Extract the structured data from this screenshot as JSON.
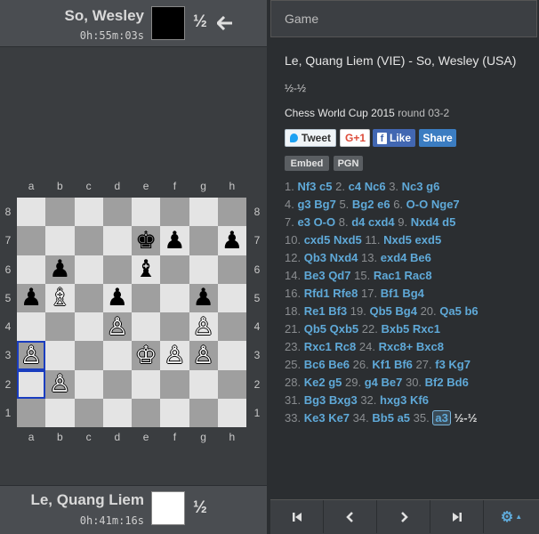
{
  "players": {
    "top": {
      "name": "So, Wesley",
      "clock": "0h:55m:03s",
      "color": "#000000",
      "result": "½"
    },
    "bottom": {
      "name": "Le, Quang Liem",
      "clock": "0h:41m:16s",
      "color": "#ffffff",
      "result": "½"
    }
  },
  "board": {
    "files": [
      "a",
      "b",
      "c",
      "d",
      "e",
      "f",
      "g",
      "h"
    ],
    "ranks": [
      "8",
      "7",
      "6",
      "5",
      "4",
      "3",
      "2",
      "1"
    ],
    "pieces": [
      {
        "sq": "e7",
        "glyph": "♚",
        "side": "b"
      },
      {
        "sq": "f7",
        "glyph": "♟",
        "side": "b"
      },
      {
        "sq": "h7",
        "glyph": "♟",
        "side": "b"
      },
      {
        "sq": "b6",
        "glyph": "♟",
        "side": "b"
      },
      {
        "sq": "e6",
        "glyph": "♝",
        "side": "b"
      },
      {
        "sq": "a5",
        "glyph": "♟",
        "side": "b"
      },
      {
        "sq": "b5",
        "glyph": "♗",
        "side": "w"
      },
      {
        "sq": "d5",
        "glyph": "♟",
        "side": "b"
      },
      {
        "sq": "g5",
        "glyph": "♟",
        "side": "b"
      },
      {
        "sq": "d4",
        "glyph": "♙",
        "side": "w"
      },
      {
        "sq": "g4",
        "glyph": "♙",
        "side": "w"
      },
      {
        "sq": "a3",
        "glyph": "♙",
        "side": "w"
      },
      {
        "sq": "e3",
        "glyph": "♔",
        "side": "w"
      },
      {
        "sq": "f3",
        "glyph": "♙",
        "side": "w"
      },
      {
        "sq": "g3",
        "glyph": "♙",
        "side": "w"
      },
      {
        "sq": "b2",
        "glyph": "♙",
        "side": "w"
      }
    ],
    "highlight": [
      "a3",
      "a2"
    ]
  },
  "panel": {
    "header": "Game",
    "title": "Le, Quang Liem (VIE) - So, Wesley (USA)",
    "result": "½-½",
    "event": "Chess World Cup 2015",
    "round": "round 03-2",
    "tweet": "Tweet",
    "gplus": "G+1",
    "like": "Like",
    "share": "Share",
    "embed": "Embed",
    "pgn": "PGN"
  },
  "moves": [
    [
      "1.",
      "Nf3",
      "c5",
      "2.",
      "c4",
      "Nc6",
      "3.",
      "Nc3",
      "g6"
    ],
    [
      "4.",
      "g3",
      "Bg7",
      "5.",
      "Bg2",
      "e6",
      "6.",
      "O-O",
      "Nge7"
    ],
    [
      "7.",
      "e3",
      "O-O",
      "8.",
      "d4",
      "cxd4",
      "9.",
      "Nxd4",
      "d5"
    ],
    [
      "10.",
      "cxd5",
      "Nxd5",
      "11.",
      "Nxd5",
      "exd5"
    ],
    [
      "12.",
      "Qb3",
      "Nxd4",
      "13.",
      "exd4",
      "Be6"
    ],
    [
      "14.",
      "Be3",
      "Qd7",
      "15.",
      "Rac1",
      "Rac8"
    ],
    [
      "16.",
      "Rfd1",
      "Rfe8",
      "17.",
      "Bf1",
      "Bg4"
    ],
    [
      "18.",
      "Re1",
      "Bf3",
      "19.",
      "Qb5",
      "Bg4",
      "20.",
      "Qa5",
      "b6"
    ],
    [
      "21.",
      "Qb5",
      "Qxb5",
      "22.",
      "Bxb5",
      "Rxc1"
    ],
    [
      "23.",
      "Rxc1",
      "Rc8",
      "24.",
      "Rxc8+",
      "Bxc8"
    ],
    [
      "25.",
      "Bc6",
      "Be6",
      "26.",
      "Kf1",
      "Bf6",
      "27.",
      "f3",
      "Kg7"
    ],
    [
      "28.",
      "Ke2",
      "g5",
      "29.",
      "g4",
      "Be7",
      "30.",
      "Bf2",
      "Bd6"
    ],
    [
      "31.",
      "Bg3",
      "Bxg3",
      "32.",
      "hxg3",
      "Kf6"
    ],
    [
      "33.",
      "Ke3",
      "Ke7",
      "34.",
      "Bb5",
      "a5",
      "35.",
      "a3",
      "½-½"
    ]
  ],
  "current_move": "a3",
  "nav": [
    "first",
    "prev",
    "next",
    "last",
    "settings"
  ],
  "icons": {
    "arrow": "arrow-left-icon",
    "settings": "gear-icon"
  }
}
